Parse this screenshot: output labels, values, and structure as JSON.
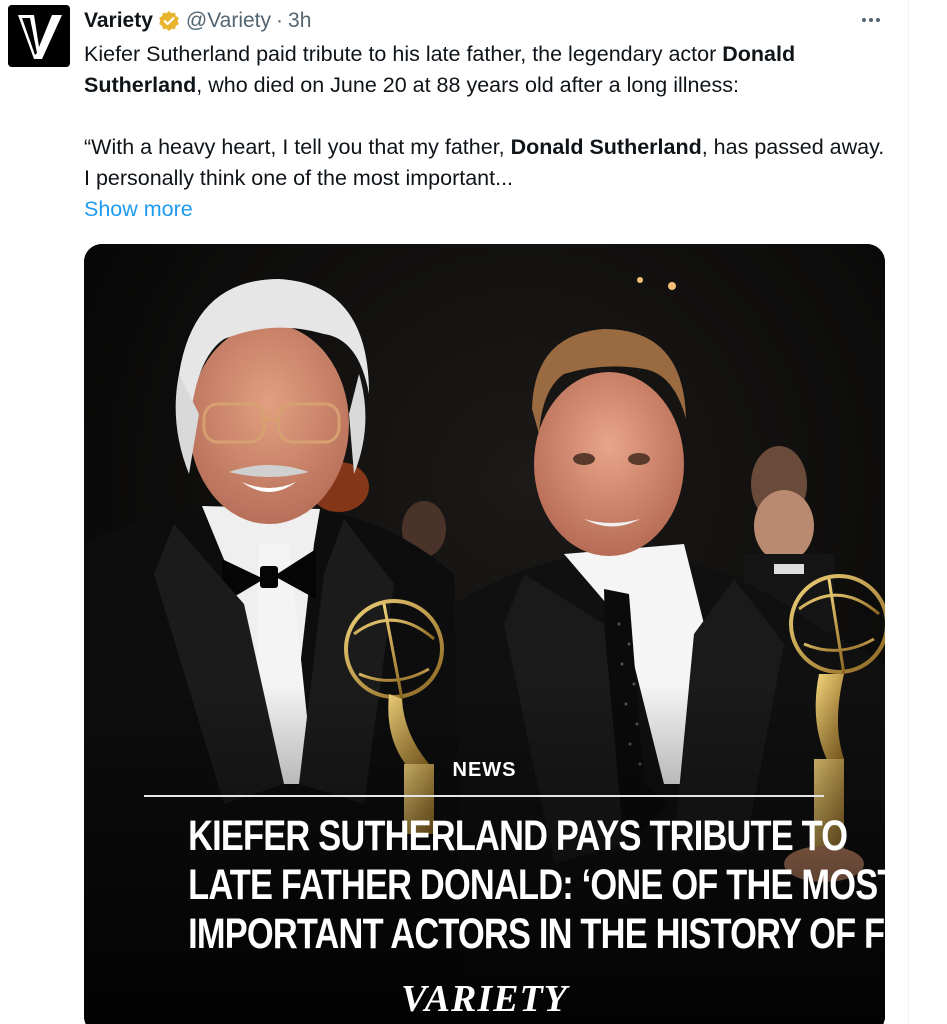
{
  "tweet": {
    "display_name": "Variety",
    "handle": "@Variety",
    "separator": "·",
    "time": "3h",
    "text_line1_prefix": "Kiefer Sutherland paid tribute to his late father, the legendary actor ",
    "text_line1_bold": "Donald Sutherland",
    "text_line1_suffix": ", who died on June 20 at 88 years old after a long illness:",
    "quote_prefix": "“With a heavy heart, I tell you that my father, ",
    "quote_bold": "Donald Sutherland",
    "quote_suffix": ", has passed away. I personally think one of the most important...",
    "show_more": "Show more"
  },
  "media": {
    "kicker": "NEWS",
    "headline_lines": [
      "KIEFER SUTHERLAND PAYS TRIBUTE TO",
      "LATE FATHER DONALD: ‘ONE OF THE MOST",
      "IMPORTANT ACTORS IN THE HISTORY OF FILM’"
    ],
    "logo_text": "VARIETY"
  },
  "icons": {
    "avatar": "variety-v-logo-icon",
    "verified": "verified-badge-icon",
    "more": "more-options-icon"
  },
  "colors": {
    "text_primary": "#0f1419",
    "text_secondary": "#536471",
    "link": "#1d9bf0",
    "verified_gold": "#e8b42e"
  }
}
